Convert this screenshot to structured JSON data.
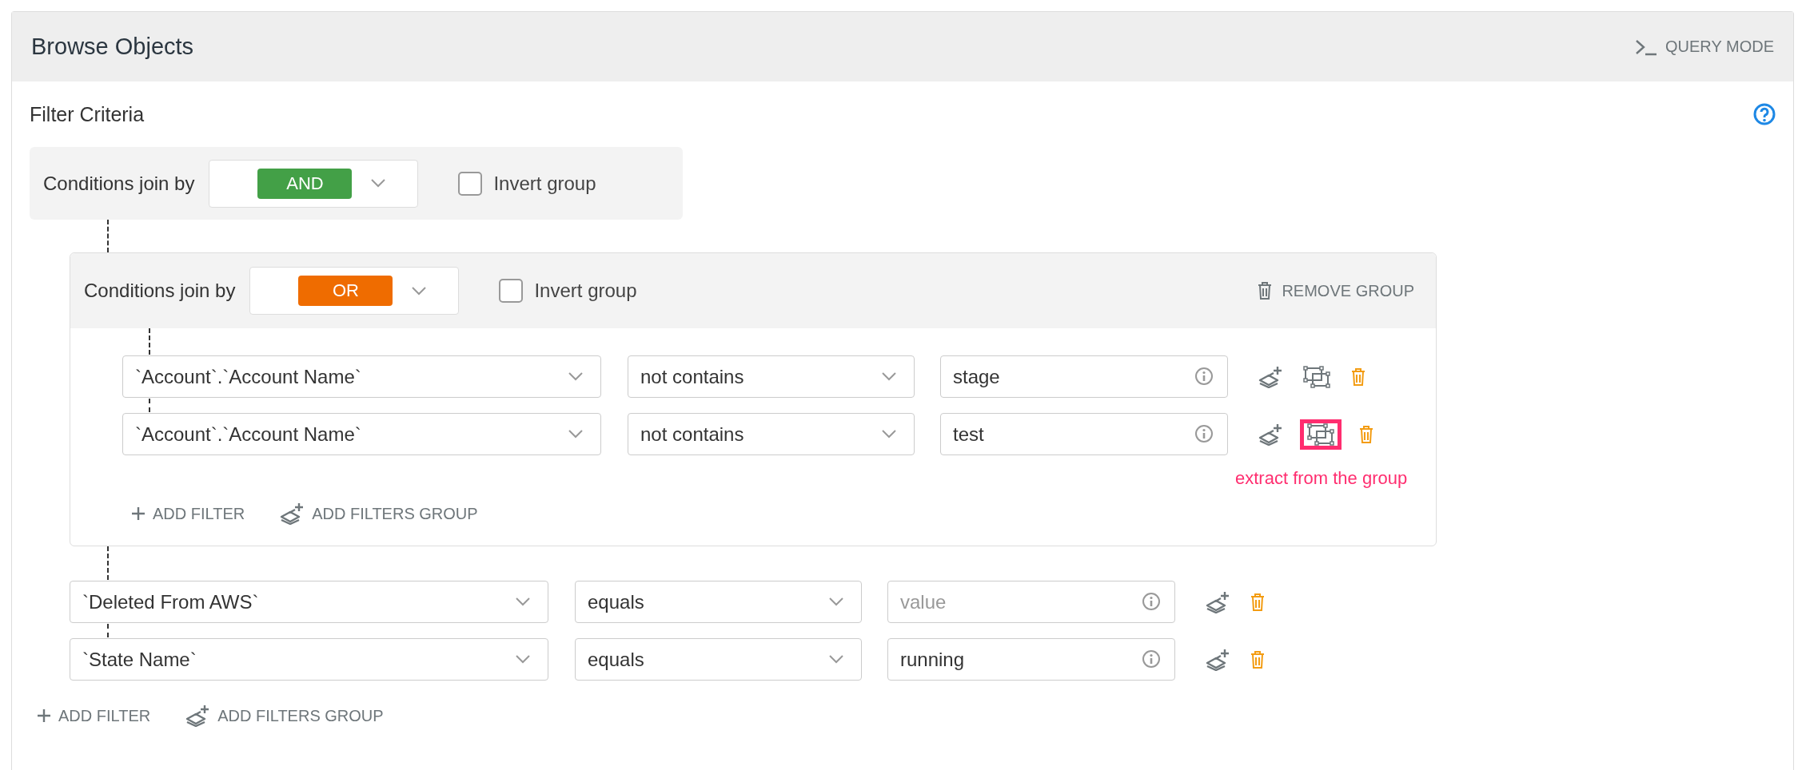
{
  "header": {
    "title": "Browse Objects",
    "query_mode": "QUERY MODE"
  },
  "filter_criteria": {
    "label": "Filter Criteria"
  },
  "root_group": {
    "join_label": "Conditions join by",
    "join": "AND",
    "color": "#43a047",
    "invert_label": "Invert group",
    "invert": false,
    "items": [
      {
        "kind": "group",
        "join_label": "Conditions join by",
        "join": "OR",
        "color": "#ef6c00",
        "invert_label": "Invert group",
        "invert": false,
        "remove_label": "REMOVE GROUP",
        "items": [
          {
            "kind": "filter",
            "field": "`Account`.`Account Name`",
            "operator": "not contains",
            "value": "stage",
            "extractable": true,
            "highlighted": false
          },
          {
            "kind": "filter",
            "field": "`Account`.`Account Name`",
            "operator": "not contains",
            "value": "test",
            "extractable": true,
            "highlighted": true,
            "annotation": "extract from the group"
          }
        ],
        "add_filter": "ADD FILTER",
        "add_group": "ADD FILTERS GROUP"
      },
      {
        "kind": "filter",
        "field": "`Deleted From AWS`",
        "operator": "equals",
        "placeholder": "value",
        "extractable": false,
        "highlighted": false
      },
      {
        "kind": "filter",
        "field": "`State Name`",
        "operator": "equals",
        "value": "running",
        "extractable": false,
        "highlighted": false
      }
    ],
    "add_filter": "ADD FILTER",
    "add_group": "ADD FILTERS GROUP"
  }
}
